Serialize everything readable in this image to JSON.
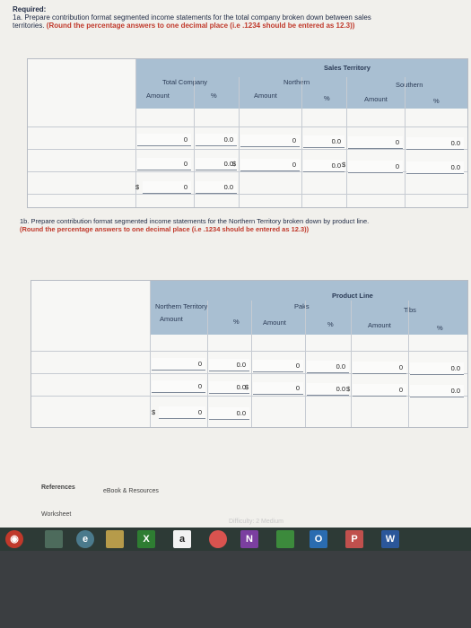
{
  "required": {
    "heading": "Required:",
    "q1a": "1a. Prepare contribution format segmented income statements for the total company broken down between sales territories.",
    "q1a_note": "(Round the percentage answers to one decimal place (i.e .1234 should be entered as 12.3))"
  },
  "table1": {
    "group_header": "Sales Territory",
    "col_total": "Total Company",
    "col_north": "Northern",
    "col_south": "Southern",
    "sub_amount": "Amount",
    "sub_pct": "%",
    "rows": [
      {
        "total": "0",
        "total_pct": "0.0",
        "north": "0",
        "north_pct": "0.0",
        "south": "0",
        "south_pct": "0.0"
      },
      {
        "total": "0",
        "total_pct": "0.0",
        "north": "0",
        "north_pct": "0.0",
        "south": "0",
        "south_pct": "0.0"
      },
      {
        "total": "0",
        "total_pct": "0.0"
      }
    ]
  },
  "q1b": {
    "text": "1b. Prepare contribution format segmented income statements for the Northern Territory broken down by product line.",
    "note": "(Round the percentage answers to one decimal place (i.e .1234 should be entered as 12.3))"
  },
  "table2": {
    "group_header": "Product Line",
    "col_total": "Northern Territory",
    "col_paks": "Paks",
    "col_tibs": "Tibs",
    "sub_amount": "Amount",
    "sub_pct": "%",
    "rows": [
      {
        "total": "0",
        "total_pct": "0.0",
        "paks": "0",
        "paks_pct": "0.0",
        "tibs": "0",
        "tibs_pct": "0.0"
      },
      {
        "total": "0",
        "total_pct": "0.0",
        "paks": "0",
        "paks_pct": "0.0",
        "tibs": "0",
        "tibs_pct": "0.0"
      },
      {
        "total": "0",
        "total_pct": "0.0"
      }
    ]
  },
  "dollar": "$",
  "footer": {
    "references": "References",
    "ebook": "eBook & Resources",
    "worksheet": "Worksheet",
    "ghost": "Difficulty: 2 Medium"
  },
  "taskbar": {
    "excel": "X",
    "amazon": "a",
    "onenote": "N",
    "outlook": "O",
    "powerpoint": "P",
    "word": "W"
  }
}
